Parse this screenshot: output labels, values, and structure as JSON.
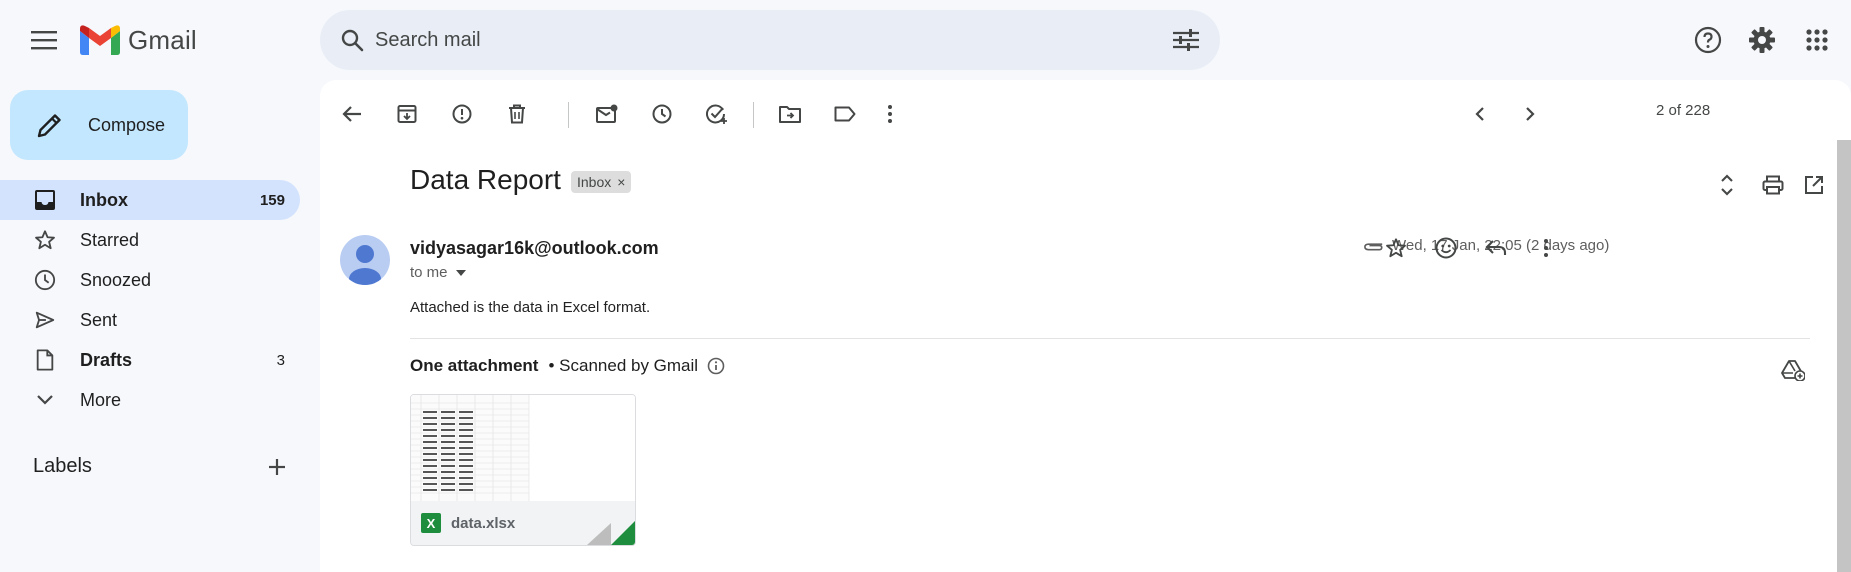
{
  "app": {
    "name": "Gmail",
    "brand_colors": {
      "red": "#ea4335",
      "blue": "#4285f4",
      "green": "#34a853",
      "yellow": "#fbbc04"
    }
  },
  "search": {
    "placeholder": "Search mail",
    "value": ""
  },
  "sidebar": {
    "compose_label": "Compose",
    "items": [
      {
        "label": "Inbox",
        "icon": "inbox-icon",
        "count": "159",
        "active": true,
        "bold": true
      },
      {
        "label": "Starred",
        "icon": "star-icon",
        "count": "",
        "active": false,
        "bold": false
      },
      {
        "label": "Snoozed",
        "icon": "clock-icon",
        "count": "",
        "active": false,
        "bold": false
      },
      {
        "label": "Sent",
        "icon": "send-icon",
        "count": "",
        "active": false,
        "bold": false
      },
      {
        "label": "Drafts",
        "icon": "file-icon",
        "count": "3",
        "active": false,
        "bold": true
      },
      {
        "label": "More",
        "icon": "chevron-down-icon",
        "count": "",
        "active": false,
        "bold": false
      }
    ],
    "labels_heading": "Labels"
  },
  "toolbar": {
    "pager_text": "2 of 228"
  },
  "message": {
    "subject": "Data Report",
    "label_chip": "Inbox",
    "label_chip_close": "×",
    "sender": "vidyasagar16k@outlook.com",
    "recipient_text": "to me",
    "date": "Wed, 17 Jan, 22:05 (2 days ago)",
    "body": "Attached is the data in Excel format.",
    "attachments_title": "One attachment",
    "scan_note": "• Scanned by Gmail",
    "attachment": {
      "filename": "data.xlsx",
      "type_badge": "X"
    }
  }
}
